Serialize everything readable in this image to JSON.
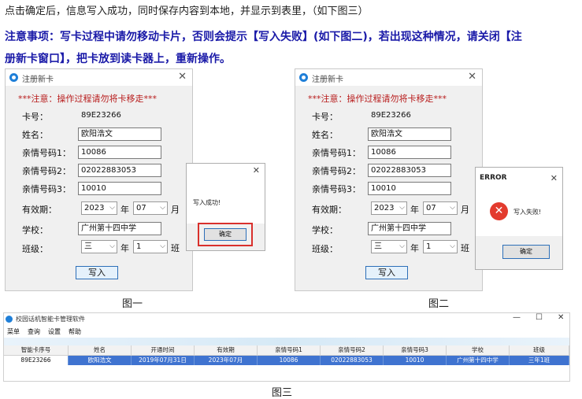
{
  "text": {
    "line1": "点击确定后，信息写入成功，同时保存内容到本地，并显示到表里，（如下图三）",
    "line2": "注意事项：写卡过程中请勿移动卡片，否则会提示【写入失败】(如下图二)，若出现这种情况，请关闭【注",
    "line3": "册新卡窗口】，把卡放到读卡器上，重新操作。"
  },
  "dialog": {
    "title": "注册新卡",
    "close": "✕",
    "notice": "***注意：操作过程请勿将卡移走***",
    "labels": {
      "card_no": "卡号：",
      "name": "姓名：",
      "phone1": "亲情号码1：",
      "phone2": "亲情号码2：",
      "phone3": "亲情号码3：",
      "valid": "有效期：",
      "school": "学校：",
      "class": "班级："
    },
    "values": {
      "card_no": "89E23266",
      "name": "欧阳浩文",
      "phone1": "10086",
      "phone2": "02022883053",
      "phone3": "10010",
      "year": "2023",
      "month": "07",
      "school": "广州第十四中学",
      "grade": "三",
      "class": "1"
    },
    "units": {
      "year": "年",
      "month": "月",
      "grade": "年",
      "class": "班"
    },
    "write_button": "写入"
  },
  "popup_success": {
    "close": "✕",
    "message": "写入成功!",
    "ok": "确定"
  },
  "popup_error": {
    "title": "ERROR",
    "close": "✕",
    "message": "写入失败!",
    "ok": "确定"
  },
  "captions": {
    "fig1": "图一",
    "fig2": "图二",
    "fig3": "图三"
  },
  "app": {
    "title": "校园话机智能卡管理软件",
    "controls": {
      "min": "—",
      "max": "☐",
      "close": "✕"
    },
    "menu": [
      "菜单",
      "查询",
      "设置",
      "帮助"
    ],
    "columns": [
      "智能卡序号",
      "姓名",
      "开通时间",
      "有效期",
      "亲情号码1",
      "亲情号码2",
      "亲情号码3",
      "学校",
      "班级"
    ],
    "rows": [
      [
        "89E23266",
        "欧阳浩文",
        "2019年07月31日",
        "2023年07月",
        "10086",
        "02022883053",
        "10010",
        "广州第十四中学",
        "三年1班"
      ]
    ]
  },
  "colors": {
    "accent": "#1a1aa8",
    "notice_red": "#b81c1c",
    "highlight_red": "#d9302c",
    "row_selected": "#3f73d0"
  }
}
